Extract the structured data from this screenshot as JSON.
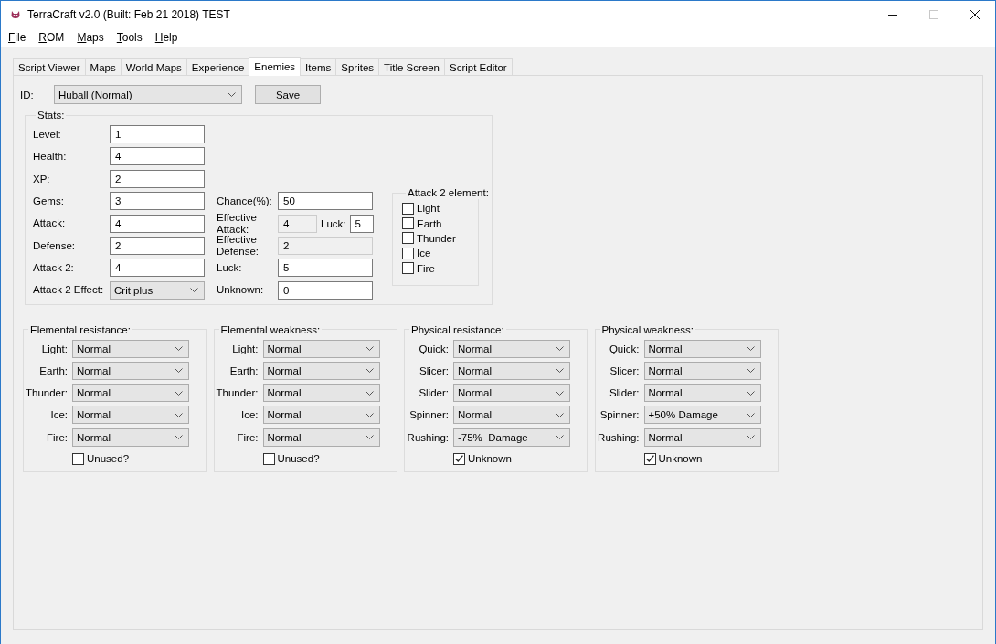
{
  "window": {
    "title": "TerraCraft v2.0 (Built: Feb 21 2018) TEST",
    "controls": [
      {
        "kind": "minimize",
        "disabled": false
      },
      {
        "kind": "maximize",
        "disabled": true
      },
      {
        "kind": "close",
        "disabled": false
      }
    ]
  },
  "menu": [
    {
      "label": "File",
      "access_key_underlined": true
    },
    {
      "label": "ROM",
      "access_key_underlined": true
    },
    {
      "label": "Maps",
      "access_key_underlined": true
    },
    {
      "label": "Tools",
      "access_key_underlined": true
    },
    {
      "label": "Help",
      "access_key_underlined": true
    }
  ],
  "tabs": [
    {
      "label": "Script Viewer",
      "selected": false
    },
    {
      "label": "Maps",
      "selected": false
    },
    {
      "label": "World Maps",
      "selected": false
    },
    {
      "label": "Experience",
      "selected": false
    },
    {
      "label": "Enemies",
      "selected": true
    },
    {
      "label": "Items",
      "selected": false
    },
    {
      "label": "Sprites",
      "selected": false
    },
    {
      "label": "Title Screen",
      "selected": false
    },
    {
      "label": "Script Editor",
      "selected": false
    }
  ],
  "enemy_select": {
    "label": "ID:",
    "value": "Huball (Normal)"
  },
  "save_button": "Save",
  "stats": {
    "title": "Stats:",
    "left_fields": [
      {
        "kind": "text",
        "label": "Level:",
        "value": "1"
      },
      {
        "kind": "text",
        "label": "Health:",
        "value": "4"
      },
      {
        "kind": "text",
        "label": "XP:",
        "value": "2"
      },
      {
        "kind": "text",
        "label": "Gems:",
        "value": "3"
      },
      {
        "kind": "text",
        "label": "Attack:",
        "value": "4"
      },
      {
        "kind": "text",
        "label": "Defense:",
        "value": "2"
      },
      {
        "kind": "text",
        "label": "Attack 2:",
        "value": "4"
      },
      {
        "kind": "dropdown",
        "label": "Attack 2 Effect:",
        "value": "Crit plus"
      }
    ],
    "right_fields": [
      {
        "label": "Chance(%):",
        "value": "50",
        "disabled": false
      },
      {
        "label": "Effective Attack:",
        "value": "4",
        "disabled": true,
        "extra": {
          "label": "Luck:",
          "value": "5"
        }
      },
      {
        "label": "Effective Defense:",
        "value": "2",
        "disabled": true
      },
      {
        "label": "Luck:",
        "value": "5",
        "disabled": false
      },
      {
        "label": "Unknown:",
        "value": "0",
        "disabled": false
      }
    ],
    "attack2_element": {
      "title": "Attack 2 element:",
      "options": [
        {
          "label": "Light",
          "checked": false
        },
        {
          "label": "Earth",
          "checked": false
        },
        {
          "label": "Thunder",
          "checked": false
        },
        {
          "label": "Ice",
          "checked": false
        },
        {
          "label": "Fire",
          "checked": false
        }
      ]
    }
  },
  "groups": [
    {
      "title": "Elemental resistance:",
      "rows": [
        {
          "label": "Light:",
          "value": "Normal"
        },
        {
          "label": "Earth:",
          "value": "Normal"
        },
        {
          "label": "Thunder:",
          "value": "Normal"
        },
        {
          "label": "Ice:",
          "value": "Normal"
        },
        {
          "label": "Fire:",
          "value": "Normal"
        }
      ],
      "checkbox": {
        "label": "Unused?",
        "checked": false
      }
    },
    {
      "title": "Elemental weakness:",
      "rows": [
        {
          "label": "Light:",
          "value": "Normal"
        },
        {
          "label": "Earth:",
          "value": "Normal"
        },
        {
          "label": "Thunder:",
          "value": "Normal"
        },
        {
          "label": "Ice:",
          "value": "Normal"
        },
        {
          "label": "Fire:",
          "value": "Normal"
        }
      ],
      "checkbox": {
        "label": "Unused?",
        "checked": false
      }
    },
    {
      "title": "Physical resistance:",
      "rows": [
        {
          "label": "Quick:",
          "value": "Normal"
        },
        {
          "label": "Slicer:",
          "value": "Normal"
        },
        {
          "label": "Slider:",
          "value": "Normal"
        },
        {
          "label": "Spinner:",
          "value": "Normal"
        },
        {
          "label": "Rushing:",
          "value": "-75%  Damage"
        }
      ],
      "checkbox": {
        "label": "Unknown",
        "checked": true
      }
    },
    {
      "title": "Physical weakness:",
      "rows": [
        {
          "label": "Quick:",
          "value": "Normal"
        },
        {
          "label": "Slicer:",
          "value": "Normal"
        },
        {
          "label": "Slider:",
          "value": "Normal"
        },
        {
          "label": "Spinner:",
          "value": "+50% Damage"
        },
        {
          "label": "Rushing:",
          "value": "Normal"
        }
      ],
      "checkbox": {
        "label": "Unknown",
        "checked": true
      }
    }
  ]
}
